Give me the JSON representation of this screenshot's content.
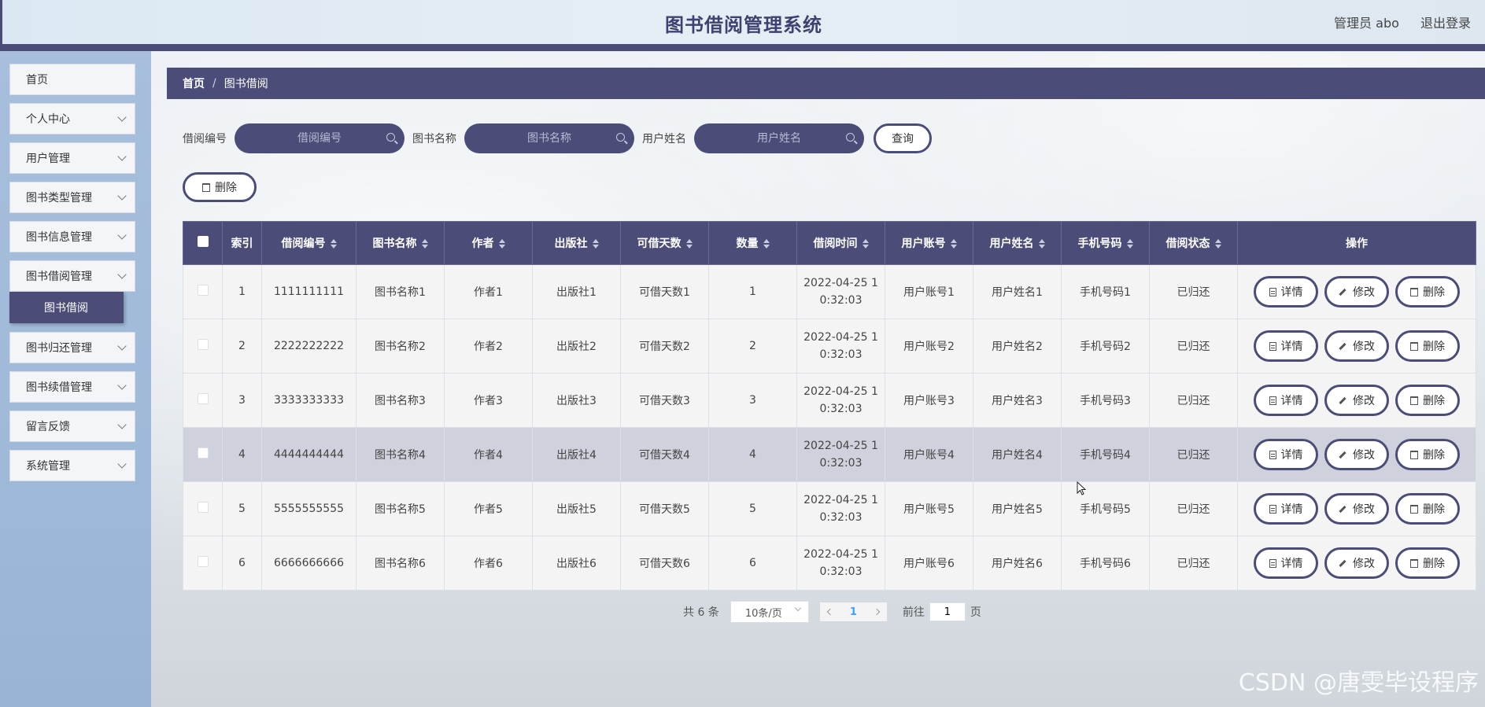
{
  "header": {
    "title": "图书借阅管理系统",
    "user": "管理员 abo",
    "logout": "退出登录"
  },
  "sidebar": {
    "items": [
      {
        "label": "首页"
      },
      {
        "label": "个人中心"
      },
      {
        "label": "用户管理"
      },
      {
        "label": "图书类型管理"
      },
      {
        "label": "图书信息管理"
      },
      {
        "label": "图书借阅管理"
      },
      {
        "label": "图书归还管理"
      },
      {
        "label": "图书续借管理"
      },
      {
        "label": "留言反馈"
      },
      {
        "label": "系统管理"
      }
    ],
    "active_sub": "图书借阅"
  },
  "breadcrumb": {
    "home": "首页",
    "separator": "/",
    "current": "图书借阅"
  },
  "search": {
    "fields": [
      {
        "label": "借阅编号",
        "placeholder": "借阅编号"
      },
      {
        "label": "图书名称",
        "placeholder": "图书名称"
      },
      {
        "label": "用户姓名",
        "placeholder": "用户姓名"
      }
    ],
    "query_label": "查询"
  },
  "toolbar": {
    "delete_label": "删除"
  },
  "table": {
    "columns": [
      "索引",
      "借阅编号",
      "图书名称",
      "作者",
      "出版社",
      "可借天数",
      "数量",
      "借阅时间",
      "用户账号",
      "用户姓名",
      "手机号码",
      "借阅状态",
      "操作"
    ],
    "rows": [
      {
        "index": "1",
        "code": "1111111111",
        "book": "图书名称1",
        "author": "作者1",
        "publisher": "出版社1",
        "days": "可借天数1",
        "qty": "1",
        "time1": "2022-04-25 1",
        "time2": "0:32:03",
        "account": "用户账号1",
        "name": "用户姓名1",
        "phone": "手机号码1",
        "status": "已归还"
      },
      {
        "index": "2",
        "code": "2222222222",
        "book": "图书名称2",
        "author": "作者2",
        "publisher": "出版社2",
        "days": "可借天数2",
        "qty": "2",
        "time1": "2022-04-25 1",
        "time2": "0:32:03",
        "account": "用户账号2",
        "name": "用户姓名2",
        "phone": "手机号码2",
        "status": "已归还"
      },
      {
        "index": "3",
        "code": "3333333333",
        "book": "图书名称3",
        "author": "作者3",
        "publisher": "出版社3",
        "days": "可借天数3",
        "qty": "3",
        "time1": "2022-04-25 1",
        "time2": "0:32:03",
        "account": "用户账号3",
        "name": "用户姓名3",
        "phone": "手机号码3",
        "status": "已归还"
      },
      {
        "index": "4",
        "code": "4444444444",
        "book": "图书名称4",
        "author": "作者4",
        "publisher": "出版社4",
        "days": "可借天数4",
        "qty": "4",
        "time1": "2022-04-25 1",
        "time2": "0:32:03",
        "account": "用户账号4",
        "name": "用户姓名4",
        "phone": "手机号码4",
        "status": "已归还"
      },
      {
        "index": "5",
        "code": "5555555555",
        "book": "图书名称5",
        "author": "作者5",
        "publisher": "出版社5",
        "days": "可借天数5",
        "qty": "5",
        "time1": "2022-04-25 1",
        "time2": "0:32:03",
        "account": "用户账号5",
        "name": "用户姓名5",
        "phone": "手机号码5",
        "status": "已归还"
      },
      {
        "index": "6",
        "code": "6666666666",
        "book": "图书名称6",
        "author": "作者6",
        "publisher": "出版社6",
        "days": "可借天数6",
        "qty": "6",
        "time1": "2022-04-25 1",
        "time2": "0:32:03",
        "account": "用户账号6",
        "name": "用户姓名6",
        "phone": "手机号码6",
        "status": "已归还"
      }
    ],
    "actions": {
      "detail": "详情",
      "edit": "修改",
      "delete": "删除"
    },
    "highlight_row": 4
  },
  "pager": {
    "total": "共 6 条",
    "page_size": "10条/页",
    "current": "1",
    "goto_label": "前往",
    "goto_value": "1",
    "page_suffix": "页"
  },
  "watermark": "CSDN @唐雯毕设程序",
  "colors": {
    "primary": "#4b4d78",
    "sidebar": "#9fb9d8",
    "highlight_row": "#cfd1dc"
  }
}
